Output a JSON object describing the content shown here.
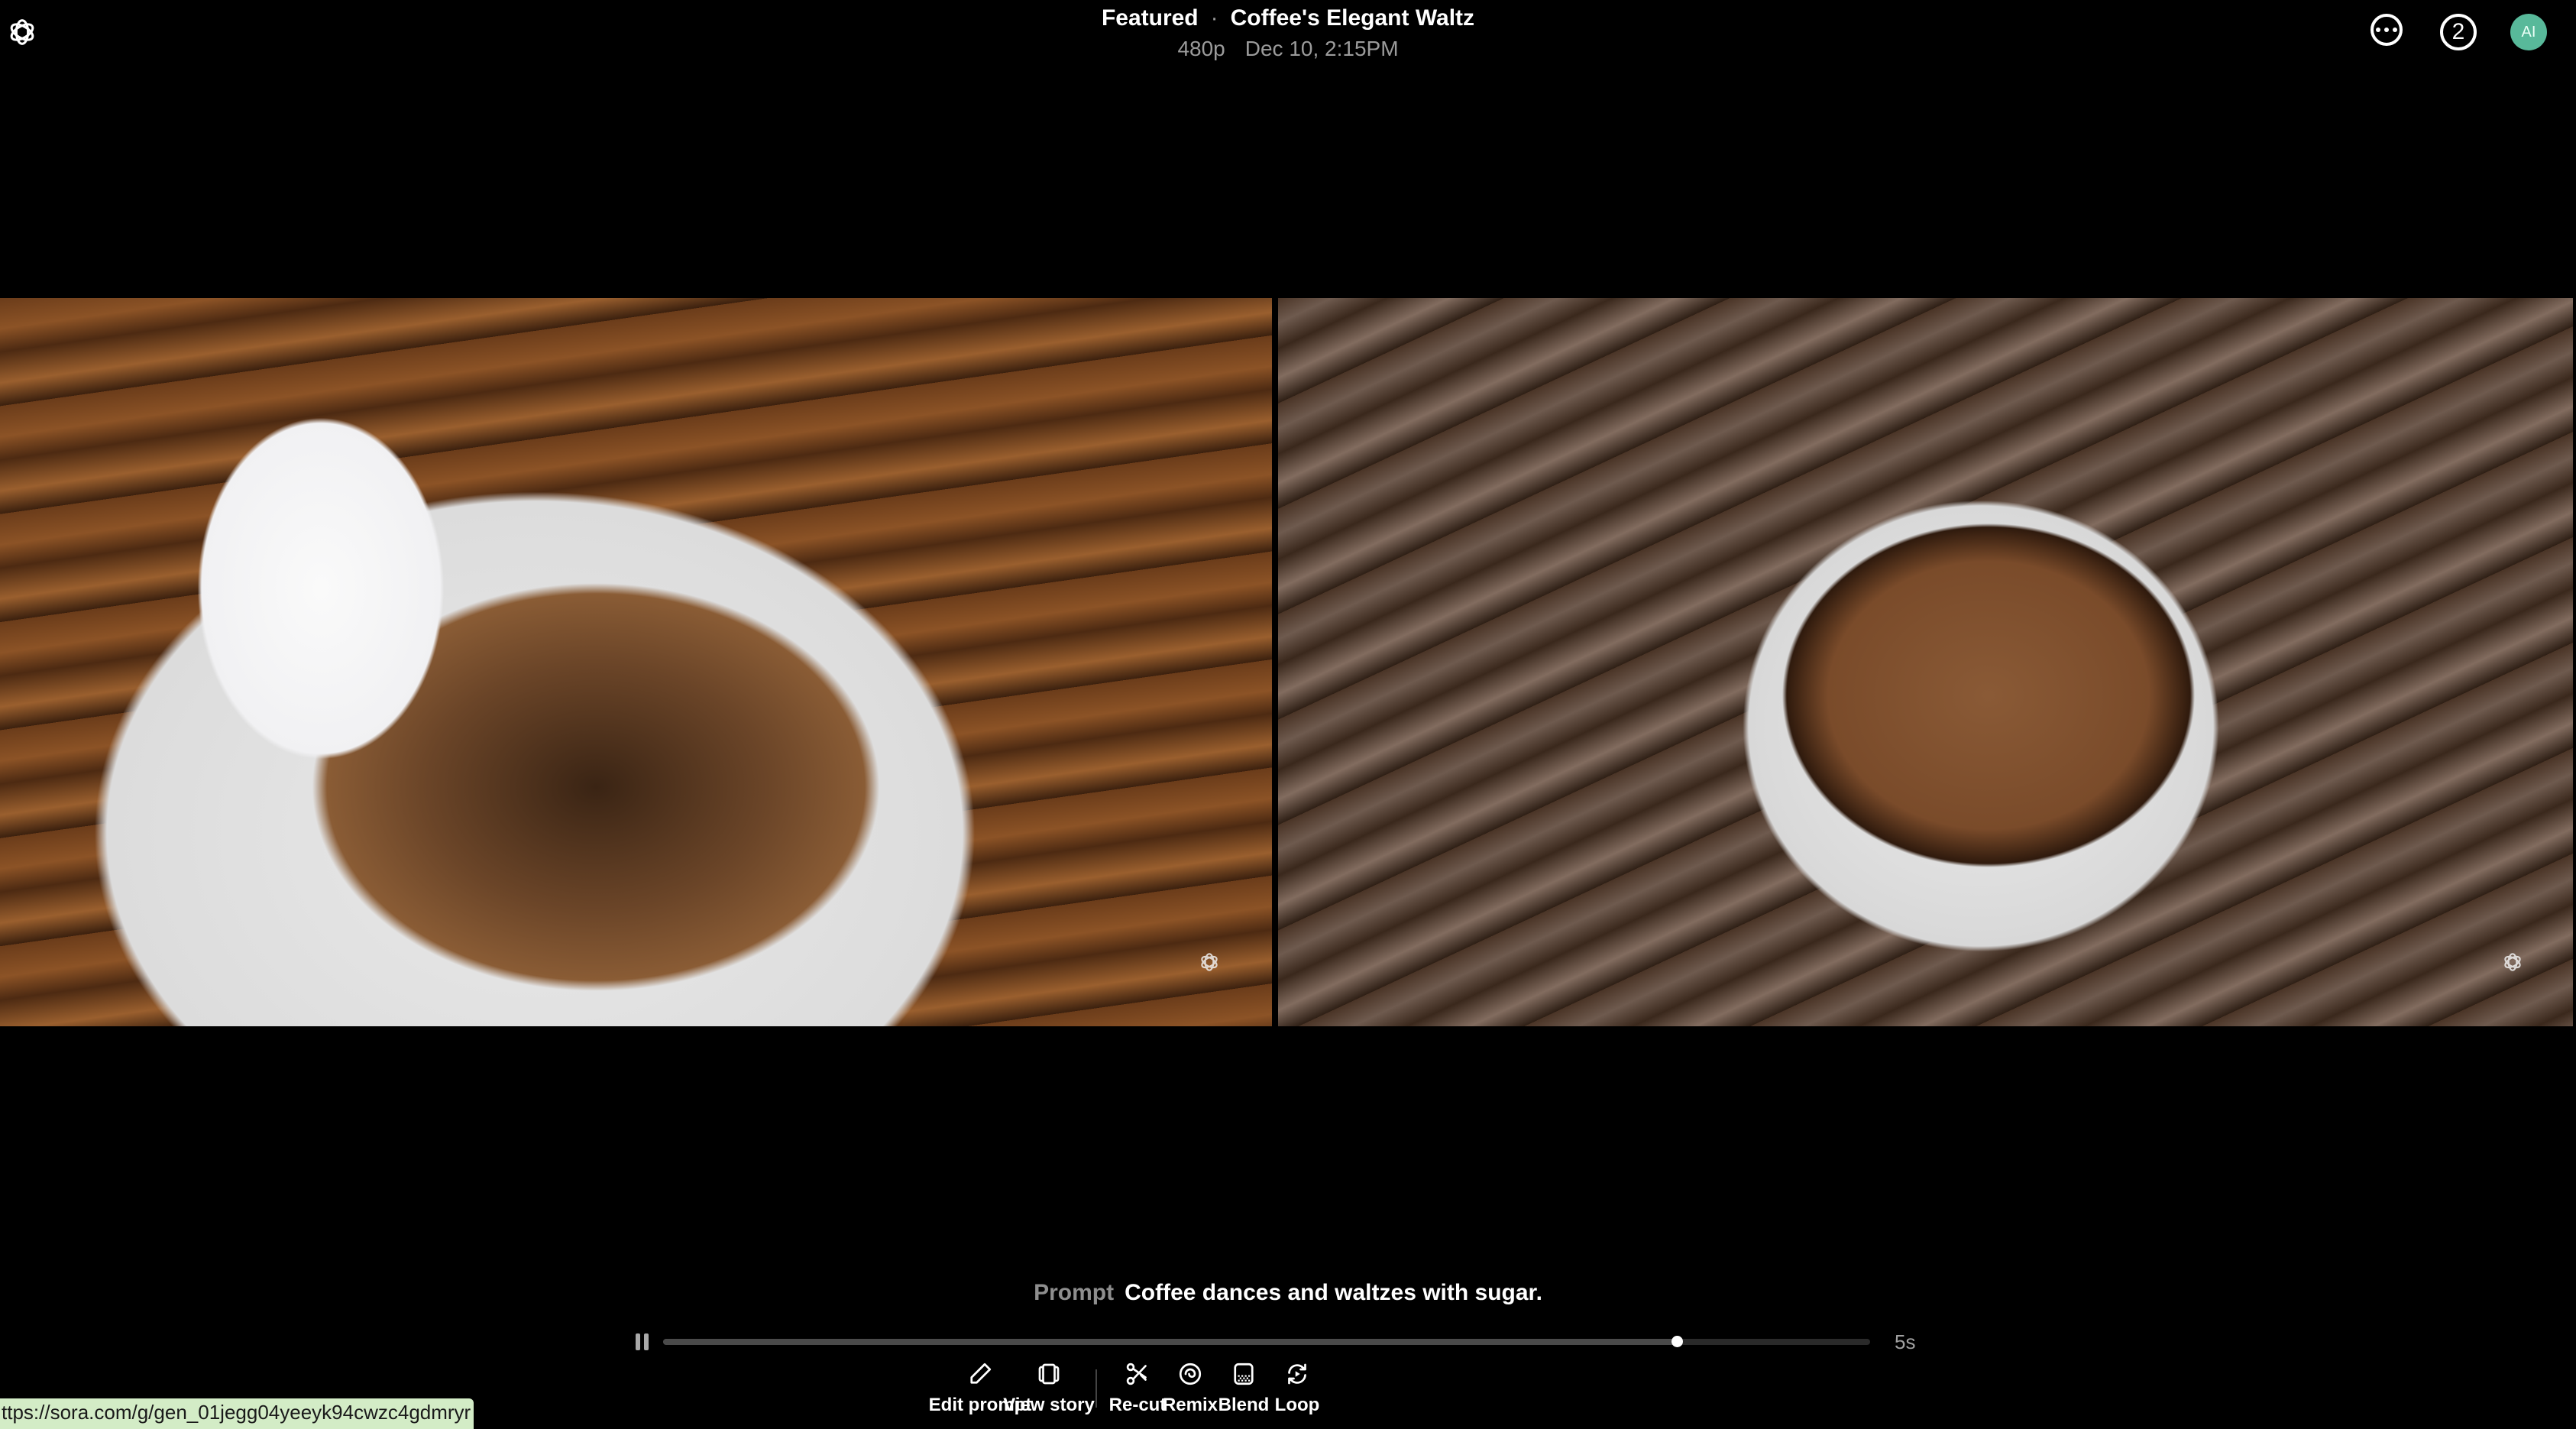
{
  "header": {
    "section": "Featured",
    "separator": "·",
    "title": "Coffee's Elegant Waltz",
    "resolution": "480p",
    "timestamp": "Dec 10, 2:15PM",
    "notification_count": "2",
    "avatar_initials": "AI",
    "avatar_color": "#58b99a"
  },
  "videos": [
    {
      "description": "Close-up of a spoonful of sugar over a white cup of frothy coffee on a wooden table"
    },
    {
      "description": "Overhead view of a white cup of coffee on a weathered wooden table"
    }
  ],
  "prompt": {
    "label": "Prompt",
    "text": "Coffee dances and waltzes with sugar."
  },
  "player": {
    "state": "playing",
    "progress": 0.84,
    "duration": "5s"
  },
  "actions": [
    {
      "label": "Edit prompt",
      "icon": "pencil-icon"
    },
    {
      "label": "View story",
      "icon": "storyboard-icon"
    },
    {
      "label": "Re-cut",
      "icon": "scissors-icon"
    },
    {
      "label": "Remix",
      "icon": "remix-icon"
    },
    {
      "label": "Blend",
      "icon": "blend-icon"
    },
    {
      "label": "Loop",
      "icon": "loop-icon"
    }
  ],
  "status_bar": {
    "url": "ttps://sora.com/g/gen_01jegg04yeeyk94cwzc4gdmryr"
  }
}
